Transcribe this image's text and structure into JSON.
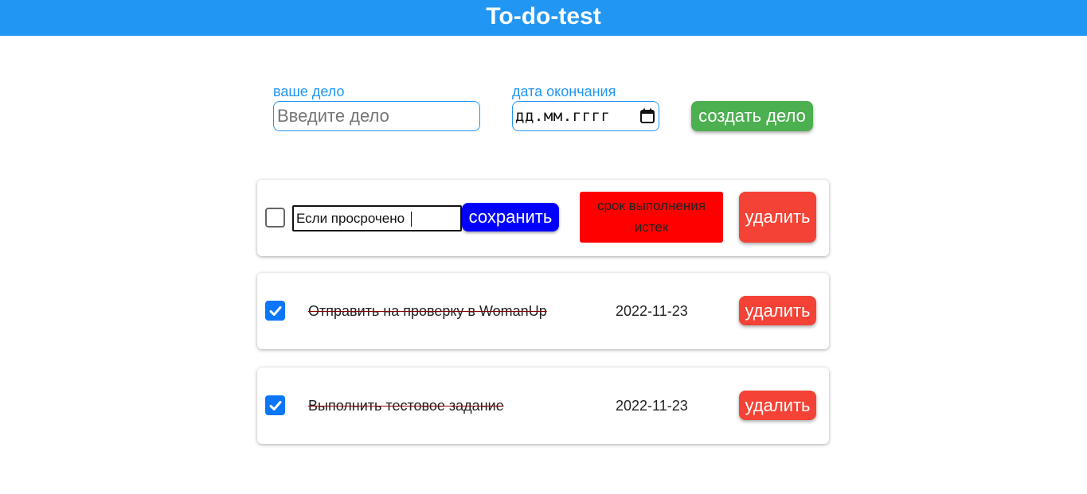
{
  "header": {
    "title": "To-do-test",
    "background": "#2196F3"
  },
  "form": {
    "task_label": "ваше дело",
    "task_placeholder": "Введите дело",
    "date_label": "дата окончания",
    "date_placeholder": "дд.мм.гггг",
    "date_icon": "calendar-icon",
    "create_label": "создать дело",
    "create_color": "#4CAF50"
  },
  "tasks": [
    {
      "checked": false,
      "editing": true,
      "edit_value": "Если просрочено",
      "save_label": "сохранить",
      "save_color": "#0000FF",
      "expired_text_1": "срок выполнения",
      "expired_text_2": "истек",
      "expired_color": "#FF0000",
      "delete_label": "удалить"
    },
    {
      "checked": true,
      "text": "Отправить на проверку в WomanUp",
      "date": "2022-11-23",
      "delete_label": "удалить"
    },
    {
      "checked": true,
      "text": "Выполнить тестовое задание",
      "date": "2022-11-23",
      "delete_label": "удалить"
    }
  ],
  "colors": {
    "delete": "#F44336",
    "checkbox": "#0B76F7"
  }
}
